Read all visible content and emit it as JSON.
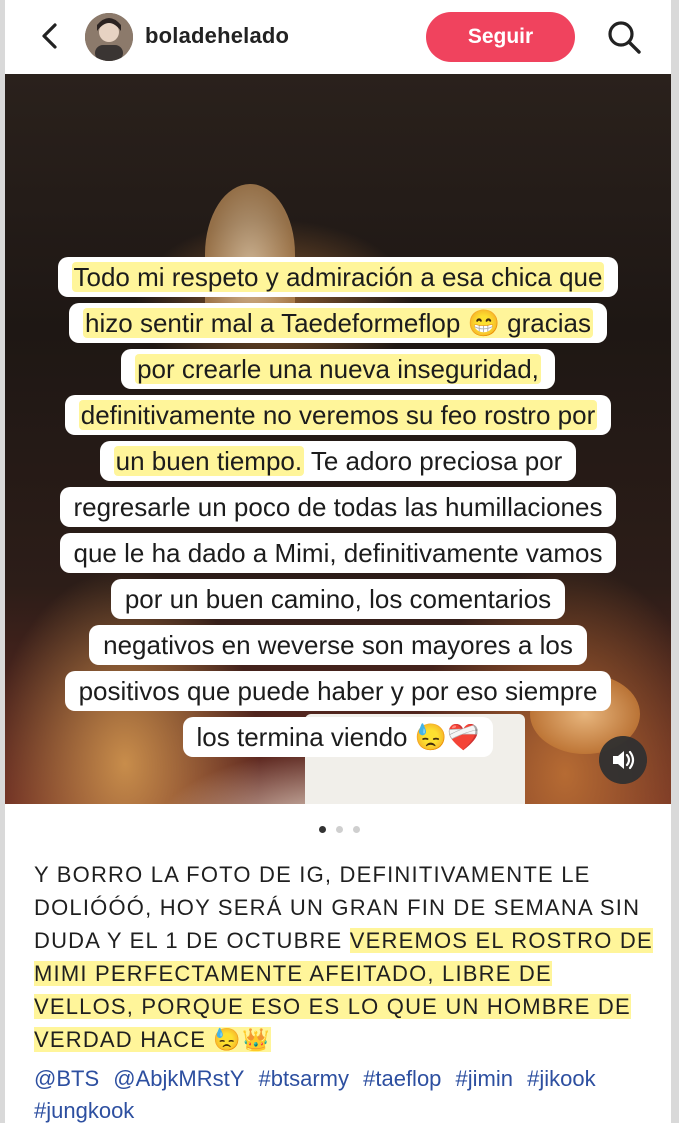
{
  "header": {
    "username": "boladehelado",
    "follow_label": "Seguir"
  },
  "icons": {
    "back": "chevron-left-icon",
    "search": "search-icon",
    "sound": "speaker-icon"
  },
  "colors": {
    "follow_button": "#f0435e",
    "highlight": "#fff59a",
    "hashtag": "#2d4fa0"
  },
  "media": {
    "overlay_lines": [
      {
        "text": "Todo mi respeto y admiración a esa chica que",
        "highlight": true
      },
      {
        "text": "hizo sentir mal a Taedeformeflop 😁 gracias",
        "highlight": true
      },
      {
        "text": "por crearle una nueva inseguridad,",
        "highlight": true
      },
      {
        "text": "definitivamente no veremos su feo rostro por",
        "highlight": true
      },
      {
        "text": "un buen tiempo.",
        "highlight": true,
        "tail": " Te adoro preciosa por"
      },
      {
        "text": "regresarle un poco de todas las humillaciones",
        "highlight": false
      },
      {
        "text": "que le ha dado a Mimi, definitivamente vamos",
        "highlight": false
      },
      {
        "text": "por un buen camino, los comentarios",
        "highlight": false
      },
      {
        "text": "negativos en weverse son mayores a los",
        "highlight": false
      },
      {
        "text": "positivos que puede haber y por eso siempre",
        "highlight": false
      },
      {
        "text": "los termina viendo 😓❤️‍🩹",
        "highlight": false
      }
    ]
  },
  "carousel": {
    "current": 1,
    "total": 3
  },
  "caption": {
    "plain": "Y BORRO LA FOTO DE IG, DEFINITIVAMENTE LE DOLIÓÓÓ, HOY SERÁ UN GRAN FIN DE SEMANA SIN DUDA Y EL 1 DE OCTUBRE ",
    "highlighted": "VEREMOS EL ROSTRO DE MIMI PERFECTAMENTE AFEITADO, LIBRE DE VELLOS, PORQUE ESO ES LO QUE UN HOMBRE DE VERDAD HACE 😓👑"
  },
  "hashtags": [
    "@BTS",
    "@AbjkMRstY",
    "#btsarmy",
    "#taeflop",
    "#jimin",
    "#jikook",
    "#jungkook"
  ]
}
